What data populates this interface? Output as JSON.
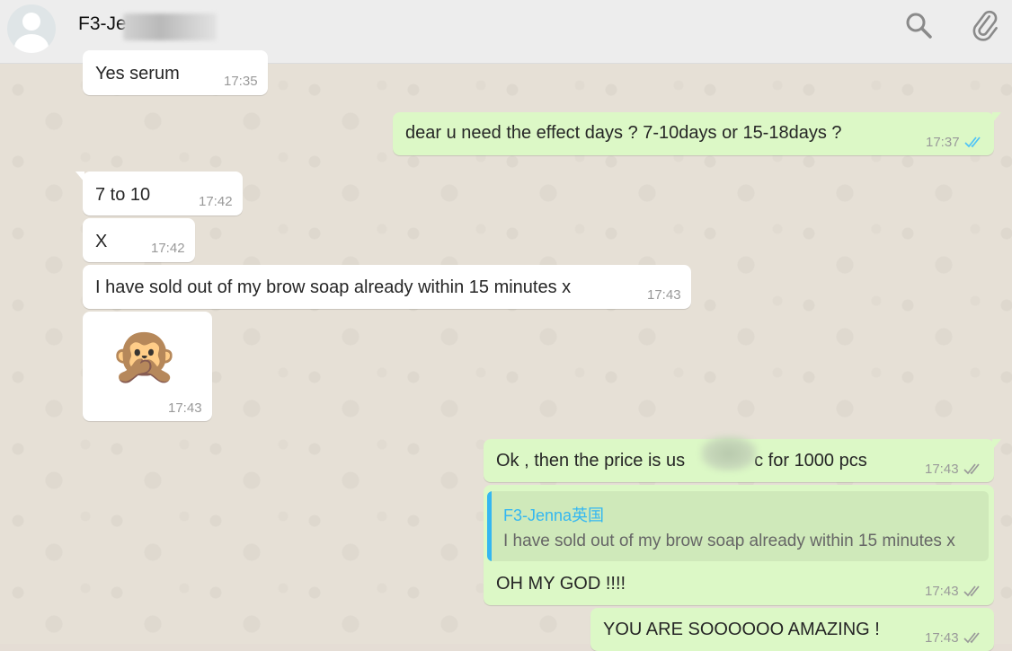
{
  "header": {
    "contact_name": "F3-Je",
    "search_icon": "search-icon",
    "attach_icon": "paperclip-icon"
  },
  "messages": [
    {
      "dir": "in",
      "text": "Yes serum",
      "time": "17:35"
    },
    {
      "dir": "out",
      "text": "dear u need the effect days ?  7-10days  or 15-18days ?",
      "time": "17:37",
      "status": "read"
    },
    {
      "dir": "in",
      "text": "7 to 10",
      "time": "17:42"
    },
    {
      "dir": "in",
      "text": "X",
      "time": "17:42"
    },
    {
      "dir": "in",
      "text": "I have sold out of my brow soap already within 15 minutes x",
      "time": "17:43"
    },
    {
      "dir": "in",
      "sticker": "see-no-evil monkey",
      "sticker_glyph": "🙊",
      "time": "17:43"
    },
    {
      "dir": "out",
      "text_before": "Ok , then  the price is us",
      "text_after": "c  for 1000 pcs",
      "time": "17:43",
      "status": "delivered"
    },
    {
      "dir": "out",
      "quote_name": "F3-Jenna英国",
      "quote_text": "I have sold out of my brow soap already within 15 minutes x",
      "text": "OH MY GOD !!!!",
      "time": "17:43",
      "status": "delivered"
    },
    {
      "dir": "out",
      "text": "YOU ARE SOOOOOO AMAZING !",
      "time": "17:43",
      "status": "delivered"
    }
  ],
  "colors": {
    "incoming": "#ffffff",
    "outgoing": "#dcf8c6",
    "read_ticks": "#4fc3f7",
    "delivered_ticks": "#999999",
    "quote_accent": "#34b7f1"
  }
}
